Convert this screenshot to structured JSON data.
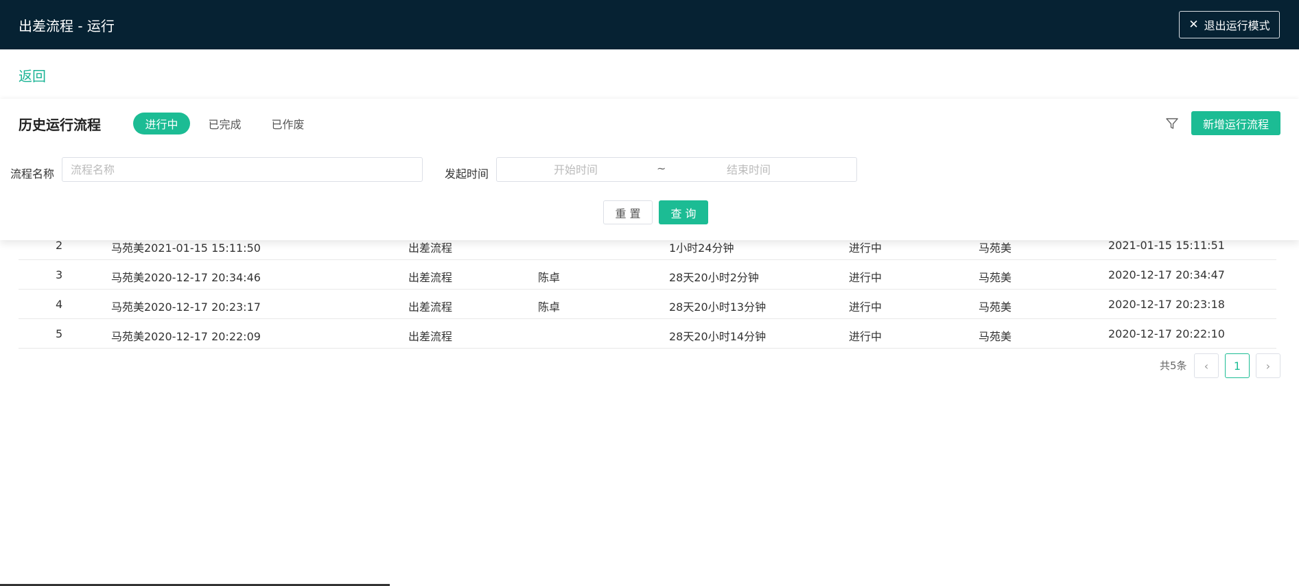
{
  "header": {
    "title": "出差流程 - 运行",
    "exit_label": "退出运行模式"
  },
  "nav": {
    "back_label": "返回"
  },
  "panel": {
    "title": "历史运行流程",
    "tabs": [
      {
        "label": "进行中",
        "active": true
      },
      {
        "label": "已完成",
        "active": false
      },
      {
        "label": "已作废",
        "active": false
      }
    ],
    "add_label": "新增运行流程"
  },
  "search": {
    "name_label": "流程名称",
    "name_placeholder": "流程名称",
    "time_label": "发起时间",
    "start_placeholder": "开始时间",
    "range_sep": "~",
    "end_placeholder": "结束时间",
    "reset_label": "重 置",
    "query_label": "查 询"
  },
  "table": {
    "rows": [
      {
        "no": "2",
        "name": "马苑美2021-01-15 15:11:50",
        "flow": "出差流程",
        "handler": "",
        "duration": "1小时24分钟",
        "status": "进行中",
        "initiator": "马苑美",
        "time": "2021-01-15 15:11:51"
      },
      {
        "no": "3",
        "name": "马苑美2020-12-17 20:34:46",
        "flow": "出差流程",
        "handler": "陈卓",
        "duration": "28天20小时2分钟",
        "status": "进行中",
        "initiator": "马苑美",
        "time": "2020-12-17 20:34:47"
      },
      {
        "no": "4",
        "name": "马苑美2020-12-17 20:23:17",
        "flow": "出差流程",
        "handler": "陈卓",
        "duration": "28天20小时13分钟",
        "status": "进行中",
        "initiator": "马苑美",
        "time": "2020-12-17 20:23:18"
      },
      {
        "no": "5",
        "name": "马苑美2020-12-17 20:22:09",
        "flow": "出差流程",
        "handler": "",
        "duration": "28天20小时14分钟",
        "status": "进行中",
        "initiator": "马苑美",
        "time": "2020-12-17 20:22:10"
      }
    ]
  },
  "pagination": {
    "total_label": "共5条",
    "current_page": "1",
    "prev_icon": "chevron-left-icon",
    "next_icon": "chevron-right-icon"
  },
  "colors": {
    "header_bg": "#062233",
    "accent": "#1cbc94"
  }
}
